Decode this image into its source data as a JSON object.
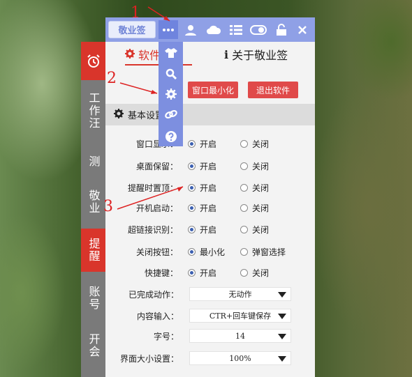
{
  "window": {
    "logo": "敬业签",
    "toolbar_icons": [
      "more-icon",
      "user-icon",
      "cloud-icon",
      "list-icon",
      "toggle-icon",
      "lock-icon",
      "close-icon"
    ]
  },
  "sidebar": {
    "items": [
      {
        "label": "工作汪",
        "active": false
      },
      {
        "label": "测",
        "active": false
      },
      {
        "label": "敬业",
        "active": false
      },
      {
        "label": "提醒",
        "active": true
      },
      {
        "label": "账号",
        "active": false
      },
      {
        "label": "开会",
        "active": false
      }
    ]
  },
  "tabs": {
    "software": "软件设置",
    "about": "关于敬业签"
  },
  "buttons": {
    "minimize": "窗口最小化",
    "exit": "退出软件"
  },
  "section": {
    "title": "基本设置"
  },
  "settings": [
    {
      "label": "窗口显示：",
      "opt1": "开启",
      "opt2": "关闭",
      "selected": 1
    },
    {
      "label": "桌面保留：",
      "opt1": "开启",
      "opt2": "关闭",
      "selected": 1
    },
    {
      "label": "提醒时置顶：",
      "opt1": "开启",
      "opt2": "关闭",
      "selected": 1
    },
    {
      "label": "开机启动：",
      "opt1": "开启",
      "opt2": "关闭",
      "selected": 1
    },
    {
      "label": "超链接识别：",
      "opt1": "开启",
      "opt2": "关闭",
      "selected": 1
    },
    {
      "label": "关闭按钮：",
      "opt1": "最小化",
      "opt2": "弹窗选择",
      "selected": 1
    },
    {
      "label": "快捷键：",
      "opt1": "开启",
      "opt2": "关闭",
      "selected": 1
    }
  ],
  "selects": [
    {
      "label": "已完成动作：",
      "value": "无动作"
    },
    {
      "label": "内容输入：",
      "value": "CTR+回车键保存"
    },
    {
      "label": "字号：",
      "value": "14"
    },
    {
      "label": "界面大小设置：",
      "value": "100%"
    }
  ],
  "dropdown_menu": [
    "shirt-icon",
    "search-icon",
    "gear-icon",
    "link-icon",
    "help-icon"
  ],
  "annotations": [
    "1",
    "2",
    "3"
  ],
  "colors": {
    "accent_blue": "#8fa0e6",
    "accent_red": "#d9352b"
  }
}
